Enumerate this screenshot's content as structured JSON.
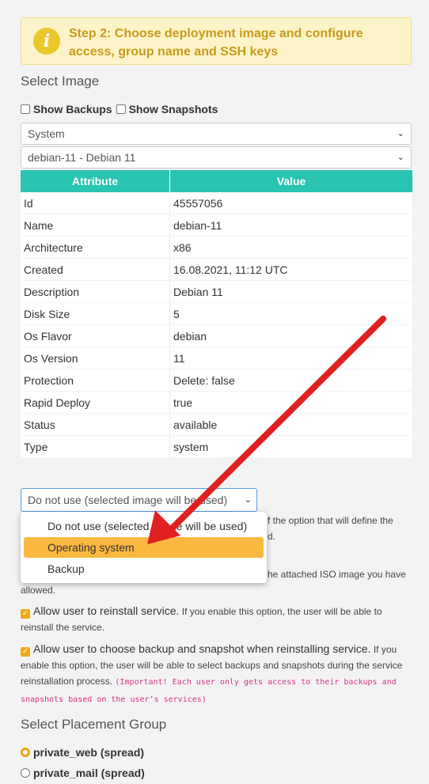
{
  "banner": {
    "icon": "info-icon",
    "icon_glyph": "i",
    "text": "Step 2: Choose deployment image and configure access, group name and SSH keys"
  },
  "select_image": {
    "title": "Select Image",
    "show_backups": "Show Backups",
    "show_snapshots": "Show Snapshots",
    "type_select": "System",
    "image_select": "debian-11 - Debian 11"
  },
  "table": {
    "headers": [
      "Attribute",
      "Value"
    ],
    "rows": [
      [
        "Id",
        "45557056"
      ],
      [
        "Name",
        "debian-11"
      ],
      [
        "Architecture",
        "x86"
      ],
      [
        "Created",
        "16.08.2021, 11:12 UTC"
      ],
      [
        "Description",
        "Debian 11"
      ],
      [
        "Disk Size",
        "5"
      ],
      [
        "Os Flavor",
        "debian"
      ],
      [
        "Os Version",
        "11"
      ],
      [
        "Protection",
        "Delete: false"
      ],
      [
        "Rapid Deploy",
        "true"
      ],
      [
        "Status",
        "available"
      ],
      [
        "Type",
        "system"
      ]
    ]
  },
  "os_select": {
    "value": "Do not use (selected image will be used)",
    "options": [
      "Do not use (selected image will be used)",
      "Operating system",
      "Backup"
    ],
    "highlighted": "Operating system"
  },
  "hidden_text": {
    "line1_tail": "f the option that will define the",
    "line2_tail": "d.",
    "line3_tail": "he attached ISO image you have",
    "line4": "allowed."
  },
  "reinstall": {
    "label": "Allow user to reinstall service.",
    "desc": "If you enable this option, the user will be able to reinstall the service."
  },
  "backup_snap": {
    "label": "Allow user to choose backup and snapshot when reinstalling service.",
    "desc": "If you enable this option, the user will be able to select backups and snapshots during the service reinstallation process.",
    "important": "(Important! Each user only gets access to their backups and snapshots based on the user’s services)"
  },
  "placement": {
    "title": "Select Placement Group",
    "options": [
      "private_web (spread)",
      "private_mail (spread)"
    ]
  },
  "colors": {
    "accent_teal": "#29c3b2",
    "highlight": "#fbb83f",
    "arrow": "#e02020"
  }
}
